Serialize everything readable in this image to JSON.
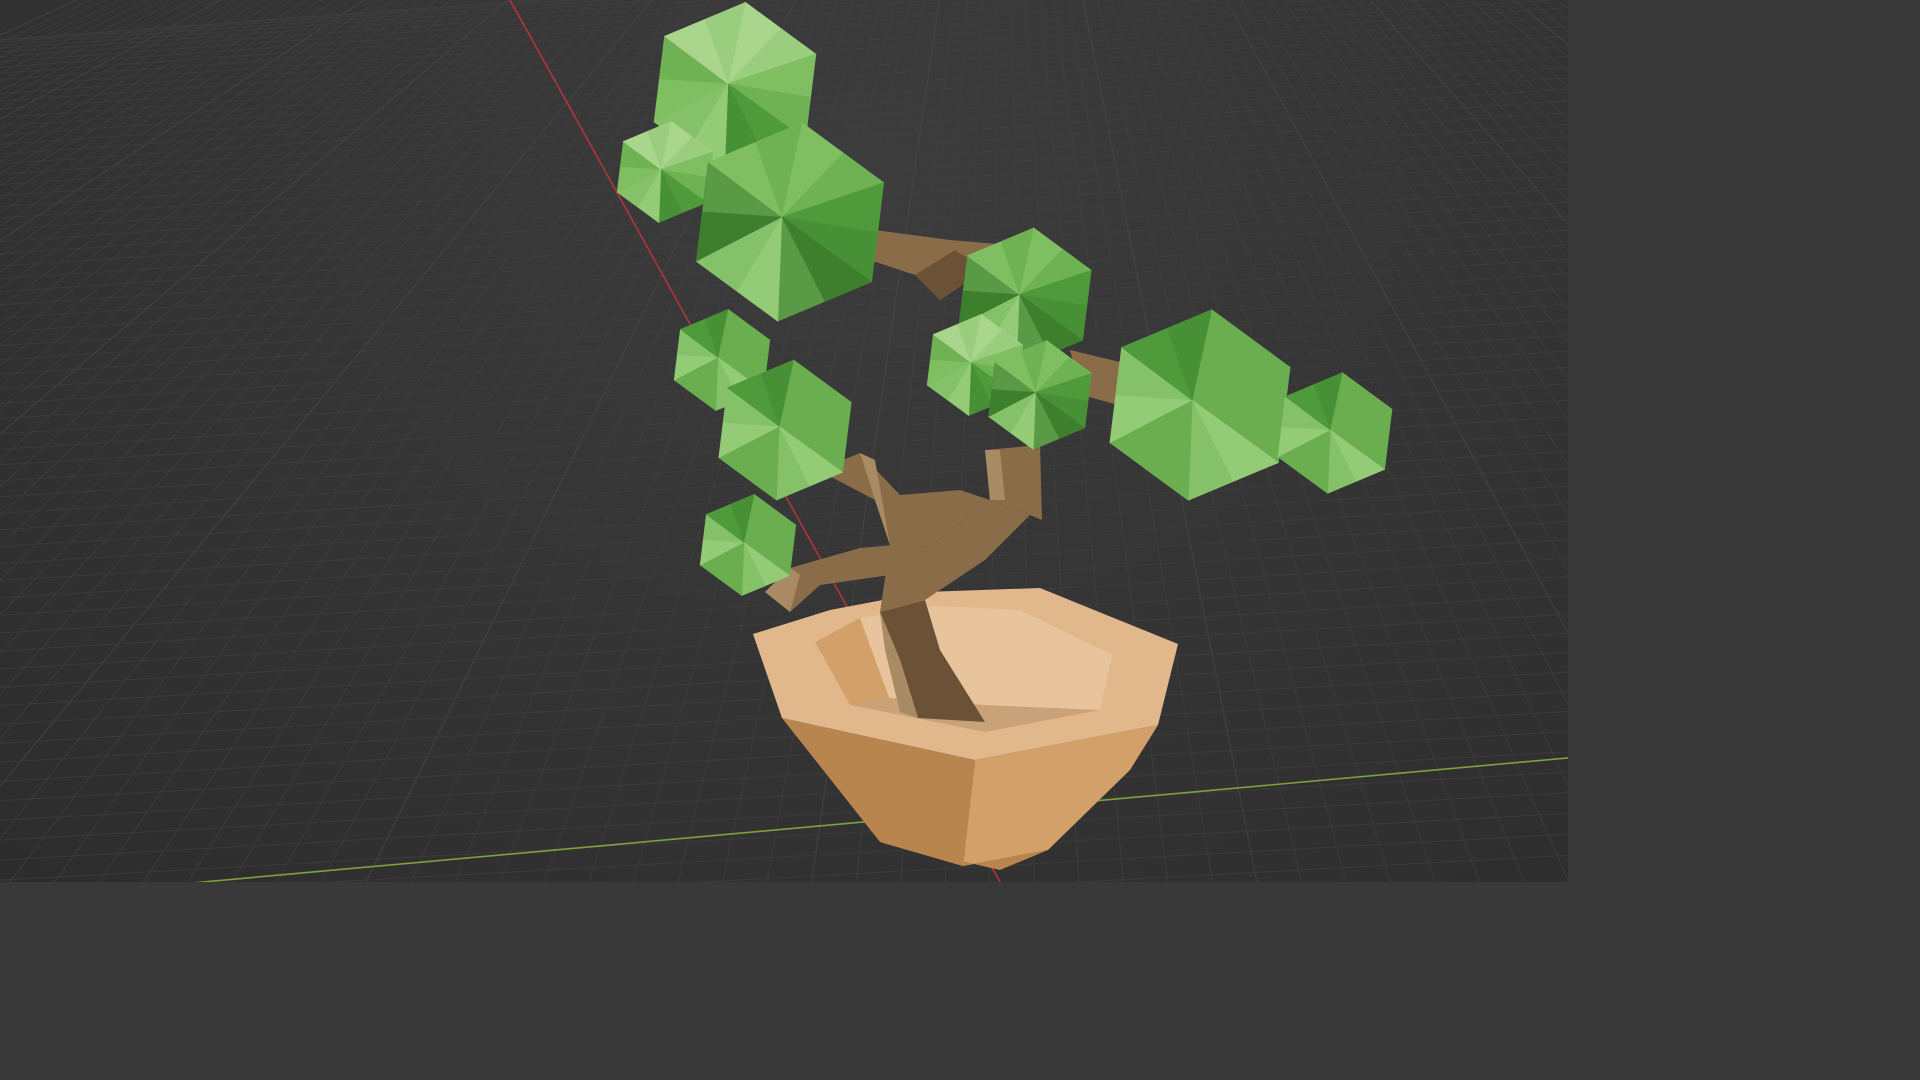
{
  "viewport": {
    "background_color": "#353535",
    "grid_color": "#4a4a4a",
    "grid_color_minor": "#404040",
    "x_axis_color": "#b2343c",
    "y_axis_color": "#7ea13a"
  },
  "scene": {
    "object": "bonsai-tree",
    "colors": {
      "foliage_light": "#a9d58c",
      "foliage_mid": "#7fbf62",
      "foliage_dark": "#4f9a3b",
      "foliage_shadow": "#3d7f2c",
      "trunk_light": "#a88a63",
      "trunk_mid": "#8a6c49",
      "trunk_dark": "#6b5236",
      "pot_light": "#e1b88c",
      "pot_mid": "#d4a06a",
      "pot_dark": "#b9854f",
      "pot_rim": "#e8c49c"
    }
  }
}
